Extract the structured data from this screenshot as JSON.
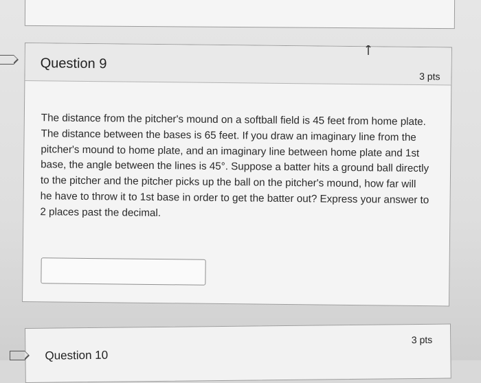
{
  "question9": {
    "title": "Question 9",
    "points": "3 pts",
    "text": "The distance from the pitcher's mound on a softball field is 45 feet from home plate. The distance between the bases is 65 feet. If you draw an imaginary line from the pitcher's mound to home plate, and an imaginary line between home plate and 1st base, the angle between the lines is 45°. Suppose a batter hits a ground ball directly to the pitcher and the pitcher picks up the ball on the pitcher's mound, how far will he have to throw it to 1st base in order to get the batter out? Express your answer to 2 places past the decimal.",
    "answer_value": ""
  },
  "question10": {
    "title": "Question 10",
    "points": "3 pts"
  },
  "icons": {
    "flag": "flag-icon",
    "cursor": "mouse-cursor-icon"
  }
}
